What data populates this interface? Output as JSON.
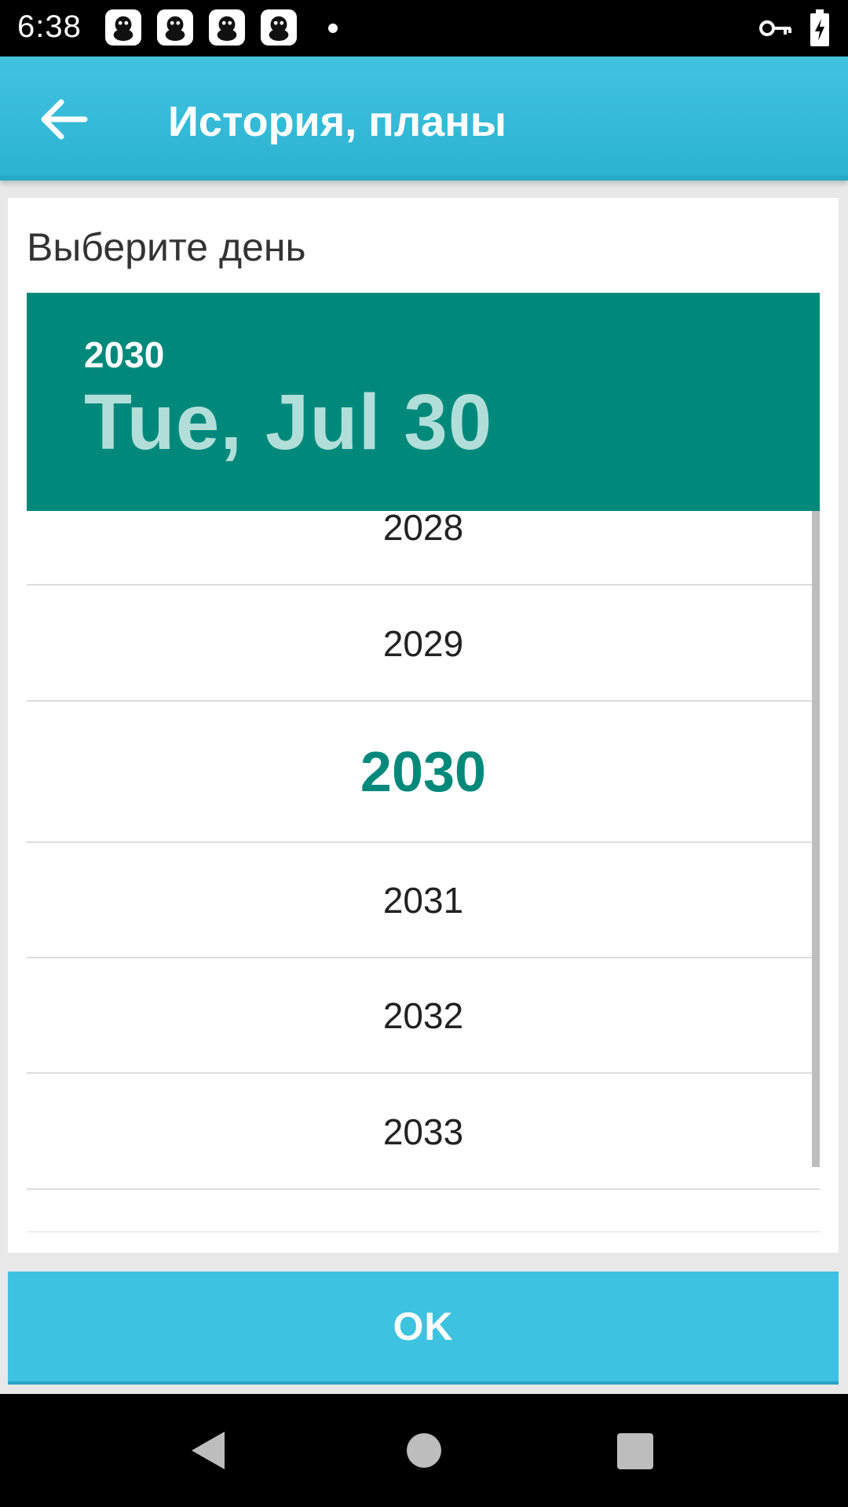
{
  "status_bar": {
    "time": "6:38",
    "notification_icons": [
      "app-notification-icon",
      "app-notification-icon",
      "app-notification-icon",
      "app-notification-icon"
    ],
    "icons": [
      "key-icon",
      "battery-charging-icon"
    ]
  },
  "app_bar": {
    "title": "История, планы",
    "back_icon": "arrow-back-icon"
  },
  "dialog": {
    "title": "Выберите день",
    "header": {
      "year": "2030",
      "date": "Tue, Jul 30"
    },
    "years": [
      {
        "label": "2028"
      },
      {
        "label": "2029"
      },
      {
        "label": "2030",
        "selected": true
      },
      {
        "label": "2031"
      },
      {
        "label": "2032"
      },
      {
        "label": "2033"
      }
    ],
    "ok_label": "OK"
  },
  "colors": {
    "app_bar": "#3dc2e0",
    "header": "#00897b",
    "selected_year": "#00897b",
    "ok_button": "#3dc2e0"
  },
  "nav_bar": {
    "icons": [
      "nav-back-icon",
      "nav-home-icon",
      "nav-recents-icon"
    ]
  }
}
